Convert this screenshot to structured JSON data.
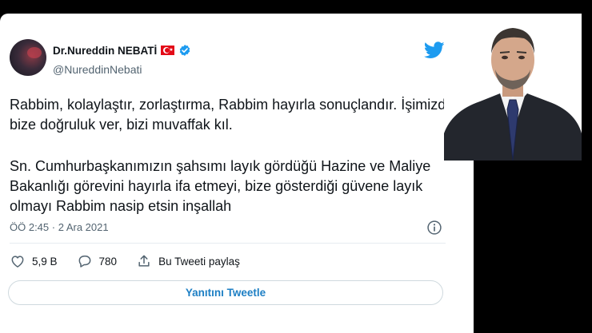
{
  "tweet": {
    "author_name": "Dr.Nureddin NEBATİ",
    "handle": "@NureddinNebati",
    "paragraph1": "Rabbim, kolaylaştır, zorlaştırma, Rabbim hayırla sonuçlandır. İşimizde bize doğruluk ver, bizi muvaffak kıl.",
    "paragraph2": "Sn. Cumhurbaşkanımızın şahsımı layık gördüğü Hazine ve Maliye Bakanlığı görevini hayırla ifa etmeyi, bize gösterdiği güvene layık olmayı Rabbim nasip etsin inşallah",
    "timestamp": "ÖÖ 2:45 · 2 Ara 2021",
    "like_count": "5,9 B",
    "reply_count": "780",
    "share_label": "Bu Tweeti paylaş",
    "reply_button_label": "Yanıtını Tweetle"
  },
  "icons": {
    "flag": "turkey-flag-icon",
    "verified": "verified-badge-icon",
    "logo": "twitter-bird-icon",
    "info": "info-icon",
    "like": "heart-icon",
    "reply": "comment-icon",
    "share": "share-icon"
  },
  "colors": {
    "twitter_blue": "#1d9bf0",
    "text_primary": "#0f1419",
    "text_secondary": "#536471",
    "background": "#000000"
  }
}
